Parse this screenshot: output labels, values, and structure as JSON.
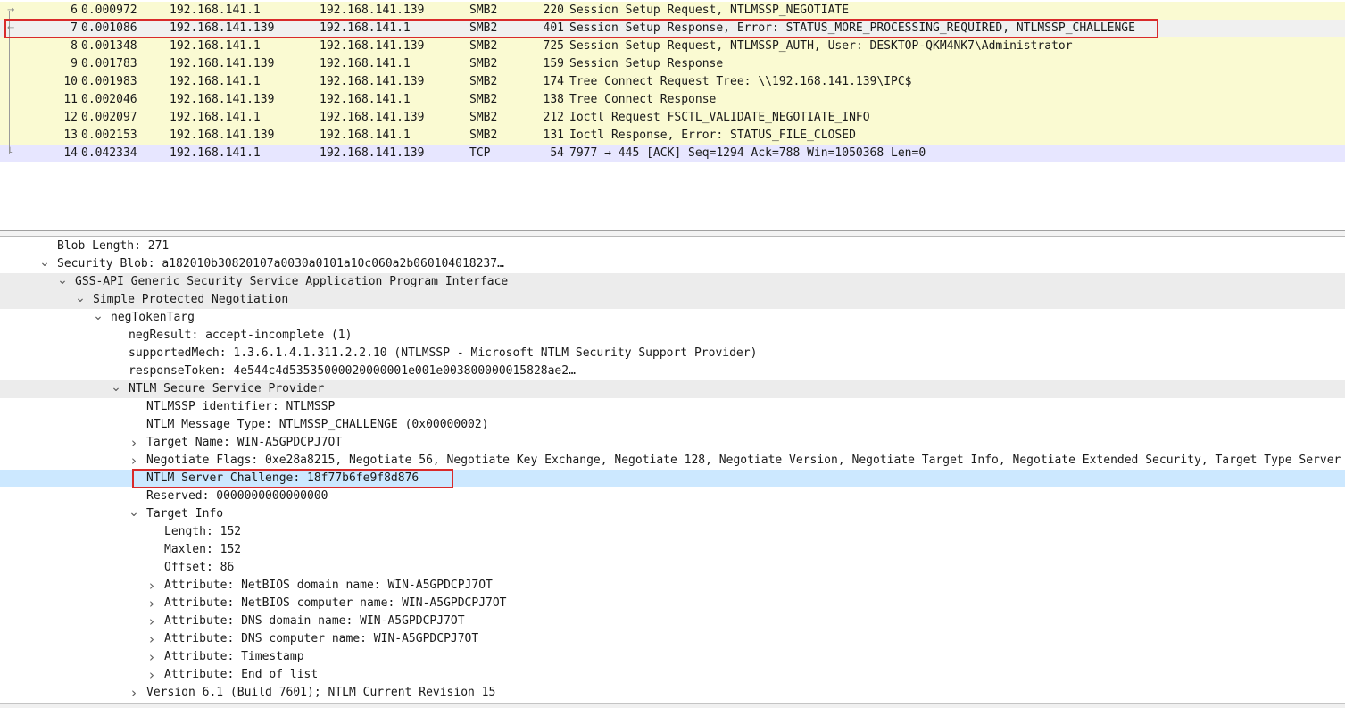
{
  "packets": [
    {
      "no": "6",
      "time": "0.000972",
      "src": "192.168.141.1",
      "dst": "192.168.141.139",
      "proto": "SMB2",
      "len": "220",
      "info": "Session Setup Request, NTLMSSP_NEGOTIATE",
      "color": "#fafad2"
    },
    {
      "no": "7",
      "time": "0.001086",
      "src": "192.168.141.139",
      "dst": "192.168.141.1",
      "proto": "SMB2",
      "len": "401",
      "info": "Session Setup Response, Error: STATUS_MORE_PROCESSING_REQUIRED, NTLMSSP_CHALLENGE",
      "color": "#f0f0f0",
      "selected": true
    },
    {
      "no": "8",
      "time": "0.001348",
      "src": "192.168.141.1",
      "dst": "192.168.141.139",
      "proto": "SMB2",
      "len": "725",
      "info": "Session Setup Request, NTLMSSP_AUTH, User: DESKTOP-QKM4NK7\\Administrator",
      "color": "#fafad2"
    },
    {
      "no": "9",
      "time": "0.001783",
      "src": "192.168.141.139",
      "dst": "192.168.141.1",
      "proto": "SMB2",
      "len": "159",
      "info": "Session Setup Response",
      "color": "#fafad2"
    },
    {
      "no": "10",
      "time": "0.001983",
      "src": "192.168.141.1",
      "dst": "192.168.141.139",
      "proto": "SMB2",
      "len": "174",
      "info": "Tree Connect Request Tree: \\\\192.168.141.139\\IPC$",
      "color": "#fafad2"
    },
    {
      "no": "11",
      "time": "0.002046",
      "src": "192.168.141.139",
      "dst": "192.168.141.1",
      "proto": "SMB2",
      "len": "138",
      "info": "Tree Connect Response",
      "color": "#fafad2"
    },
    {
      "no": "12",
      "time": "0.002097",
      "src": "192.168.141.1",
      "dst": "192.168.141.139",
      "proto": "SMB2",
      "len": "212",
      "info": "Ioctl Request FSCTL_VALIDATE_NEGOTIATE_INFO",
      "color": "#fafad2"
    },
    {
      "no": "13",
      "time": "0.002153",
      "src": "192.168.141.139",
      "dst": "192.168.141.1",
      "proto": "SMB2",
      "len": "131",
      "info": "Ioctl Response, Error: STATUS_FILE_CLOSED",
      "color": "#fafad2"
    },
    {
      "no": "14",
      "time": "0.042334",
      "src": "192.168.141.1",
      "dst": "192.168.141.139",
      "proto": "TCP",
      "len": "54",
      "info": "7977 → 445 [ACK] Seq=1294 Ack=788 Win=1050368 Len=0",
      "color": "#e7e6ff"
    }
  ],
  "details": [
    {
      "depth": 0,
      "toggle": "none",
      "text": "Blob Length: 271"
    },
    {
      "depth": 0,
      "toggle": "expanded",
      "text": "Security Blob: a182010b30820107a0030a0101a10c060a2b060104018237…"
    },
    {
      "depth": 1,
      "toggle": "expanded",
      "text": "GSS-API Generic Security Service Application Program Interface",
      "section": true
    },
    {
      "depth": 2,
      "toggle": "expanded",
      "text": "Simple Protected Negotiation",
      "section": true
    },
    {
      "depth": 3,
      "toggle": "expanded",
      "text": "negTokenTarg"
    },
    {
      "depth": 4,
      "toggle": "none",
      "text": "negResult: accept-incomplete (1)"
    },
    {
      "depth": 4,
      "toggle": "none",
      "text": "supportedMech: 1.3.6.1.4.1.311.2.2.10 (NTLMSSP - Microsoft NTLM Security Support Provider)"
    },
    {
      "depth": 4,
      "toggle": "none",
      "text": "responseToken: 4e544c4d53535000020000001e001e003800000015828ae2…"
    },
    {
      "depth": 4,
      "toggle": "expanded",
      "text": "NTLM Secure Service Provider",
      "section": true
    },
    {
      "depth": 5,
      "toggle": "none",
      "text": "NTLMSSP identifier: NTLMSSP"
    },
    {
      "depth": 5,
      "toggle": "none",
      "text": "NTLM Message Type: NTLMSSP_CHALLENGE (0x00000002)"
    },
    {
      "depth": 5,
      "toggle": "collapsed",
      "text": "Target Name: WIN-A5GPDCPJ7OT"
    },
    {
      "depth": 5,
      "toggle": "collapsed",
      "text": "Negotiate Flags: 0xe28a8215, Negotiate 56, Negotiate Key Exchange, Negotiate 128, Negotiate Version, Negotiate Target Info, Negotiate Extended Security, Target Type Server"
    },
    {
      "depth": 5,
      "toggle": "none",
      "text": "NTLM Server Challenge: 18f77b6fe9f8d876",
      "selected": true
    },
    {
      "depth": 5,
      "toggle": "none",
      "text": "Reserved: 0000000000000000"
    },
    {
      "depth": 5,
      "toggle": "expanded",
      "text": "Target Info"
    },
    {
      "depth": 6,
      "toggle": "none",
      "text": "Length: 152"
    },
    {
      "depth": 6,
      "toggle": "none",
      "text": "Maxlen: 152"
    },
    {
      "depth": 6,
      "toggle": "none",
      "text": "Offset: 86"
    },
    {
      "depth": 6,
      "toggle": "collapsed",
      "text": "Attribute: NetBIOS domain name: WIN-A5GPDCPJ7OT"
    },
    {
      "depth": 6,
      "toggle": "collapsed",
      "text": "Attribute: NetBIOS computer name: WIN-A5GPDCPJ7OT"
    },
    {
      "depth": 6,
      "toggle": "collapsed",
      "text": "Attribute: DNS domain name: WIN-A5GPDCPJ7OT"
    },
    {
      "depth": 6,
      "toggle": "collapsed",
      "text": "Attribute: DNS computer name: WIN-A5GPDCPJ7OT"
    },
    {
      "depth": 6,
      "toggle": "collapsed",
      "text": "Attribute: Timestamp"
    },
    {
      "depth": 6,
      "toggle": "collapsed",
      "text": "Attribute: End of list"
    },
    {
      "depth": 5,
      "toggle": "collapsed",
      "text": "Version 6.1 (Build 7601); NTLM Current Revision 15"
    }
  ],
  "colors": {
    "smb_row": "#fafad2",
    "tcp_row": "#e7e6ff",
    "selected_detail": "#cce8ff",
    "highlight_box": "#d92a2a"
  },
  "icons": {
    "expanded": "chevron-down-icon",
    "collapsed": "chevron-right-icon"
  }
}
